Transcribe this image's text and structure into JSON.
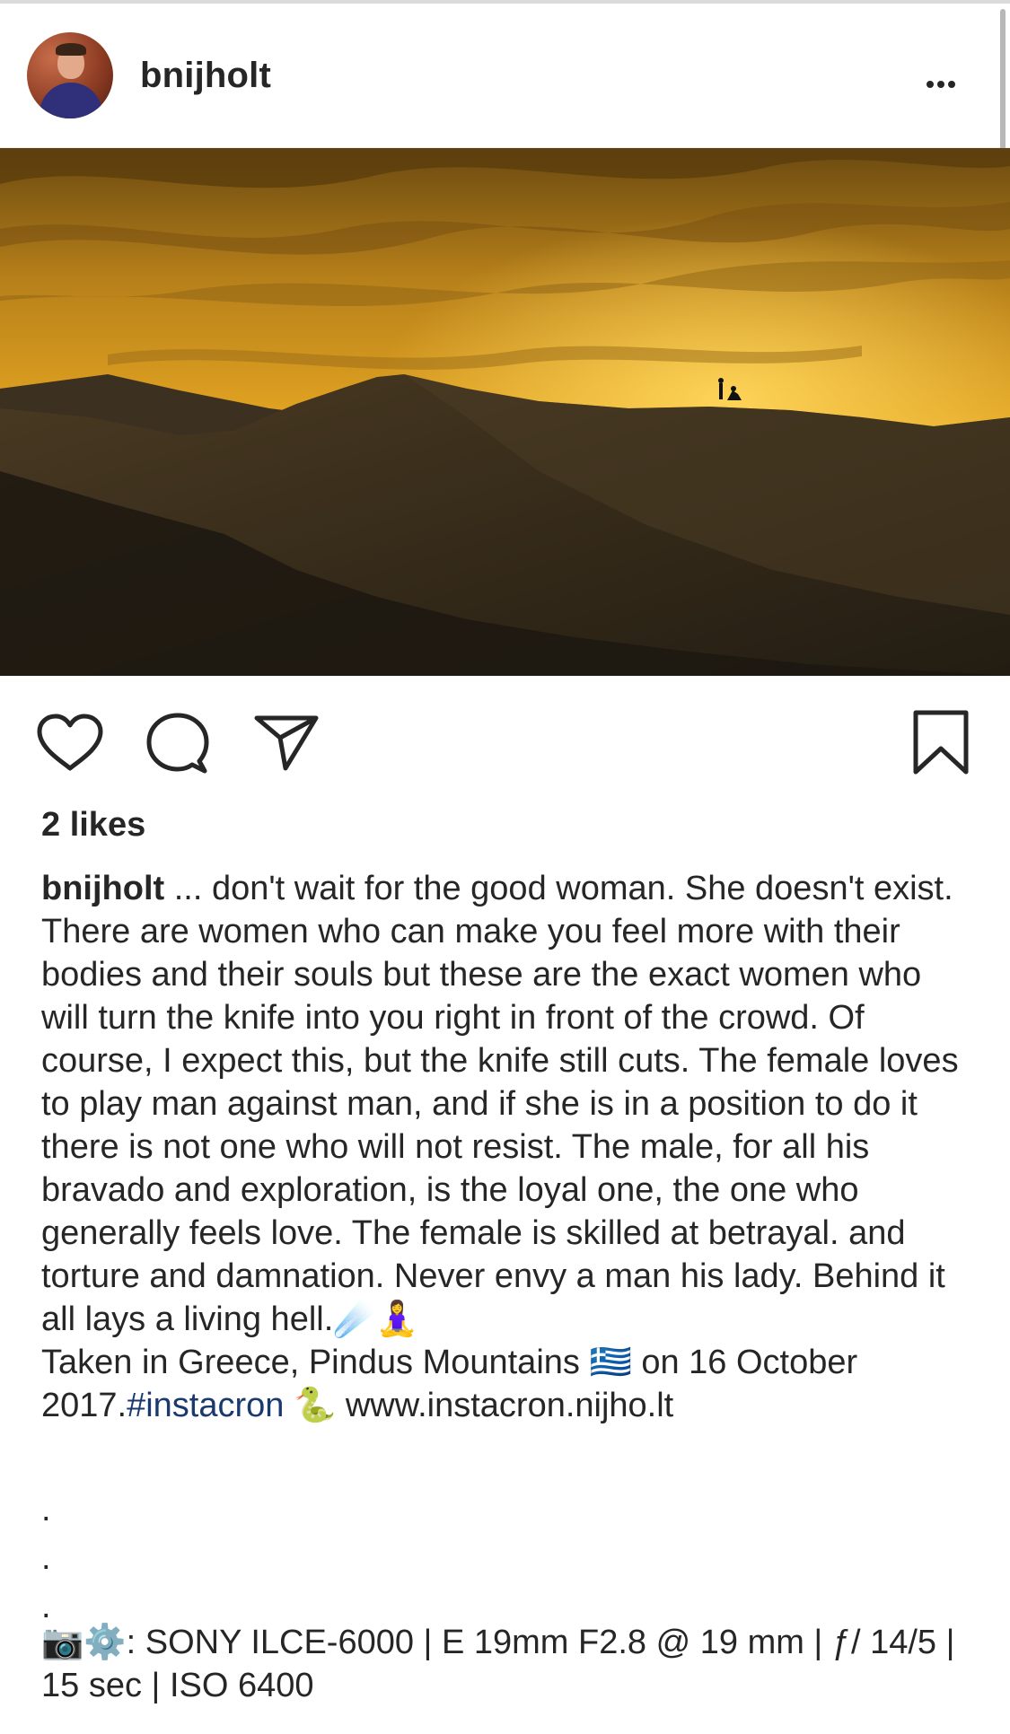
{
  "post": {
    "username": "bnijholt",
    "more_label": "More options"
  },
  "actions": {
    "like_icon": "heart-icon",
    "comment_icon": "comment-icon",
    "share_icon": "paper-plane-icon",
    "save_icon": "bookmark-icon"
  },
  "likes": {
    "text": "2 likes"
  },
  "caption": {
    "username": "bnijholt",
    "text": " ... don't wait for the good woman. She doesn't exist. There are women who can make you feel more with their bodies and their souls but these are the exact women who will turn the knife into you right in front of the crowd. Of course, I expect this, but the knife still cuts. The female loves to play man against man, and if she is in a position to do it there is not one who will not resist. The male, for all his bravado and exploration, is the loyal one, the one who generally feels love. The female is skilled at betrayal. and torture and damnation. Never envy a man his lady. Behind it all lays a living hell.",
    "emojis_1": "☄️🧘‍♀️",
    "location_text": "Taken in Greece, Pindus Mountains ",
    "flag": "🇬🇷",
    "date_text": " on 16 October 2017.",
    "hashtag": "#instacron",
    "snake": " 🐍 ",
    "link": "www.instacron.nijho.lt"
  },
  "separator_dots": [
    ".",
    ".",
    "."
  ],
  "camera_info": {
    "emojis": "📷⚙️",
    "text": ": SONY ILCE-6000 | E 19mm F2.8 @ 19 mm | ƒ/ 14/5 | 15 sec | ISO 6400"
  },
  "colors": {
    "text": "#262626",
    "hashtag": "#1a3a6e",
    "sky_top": "#c98a1a",
    "sun": "#f5b92a",
    "dunes": "#2a2418"
  }
}
